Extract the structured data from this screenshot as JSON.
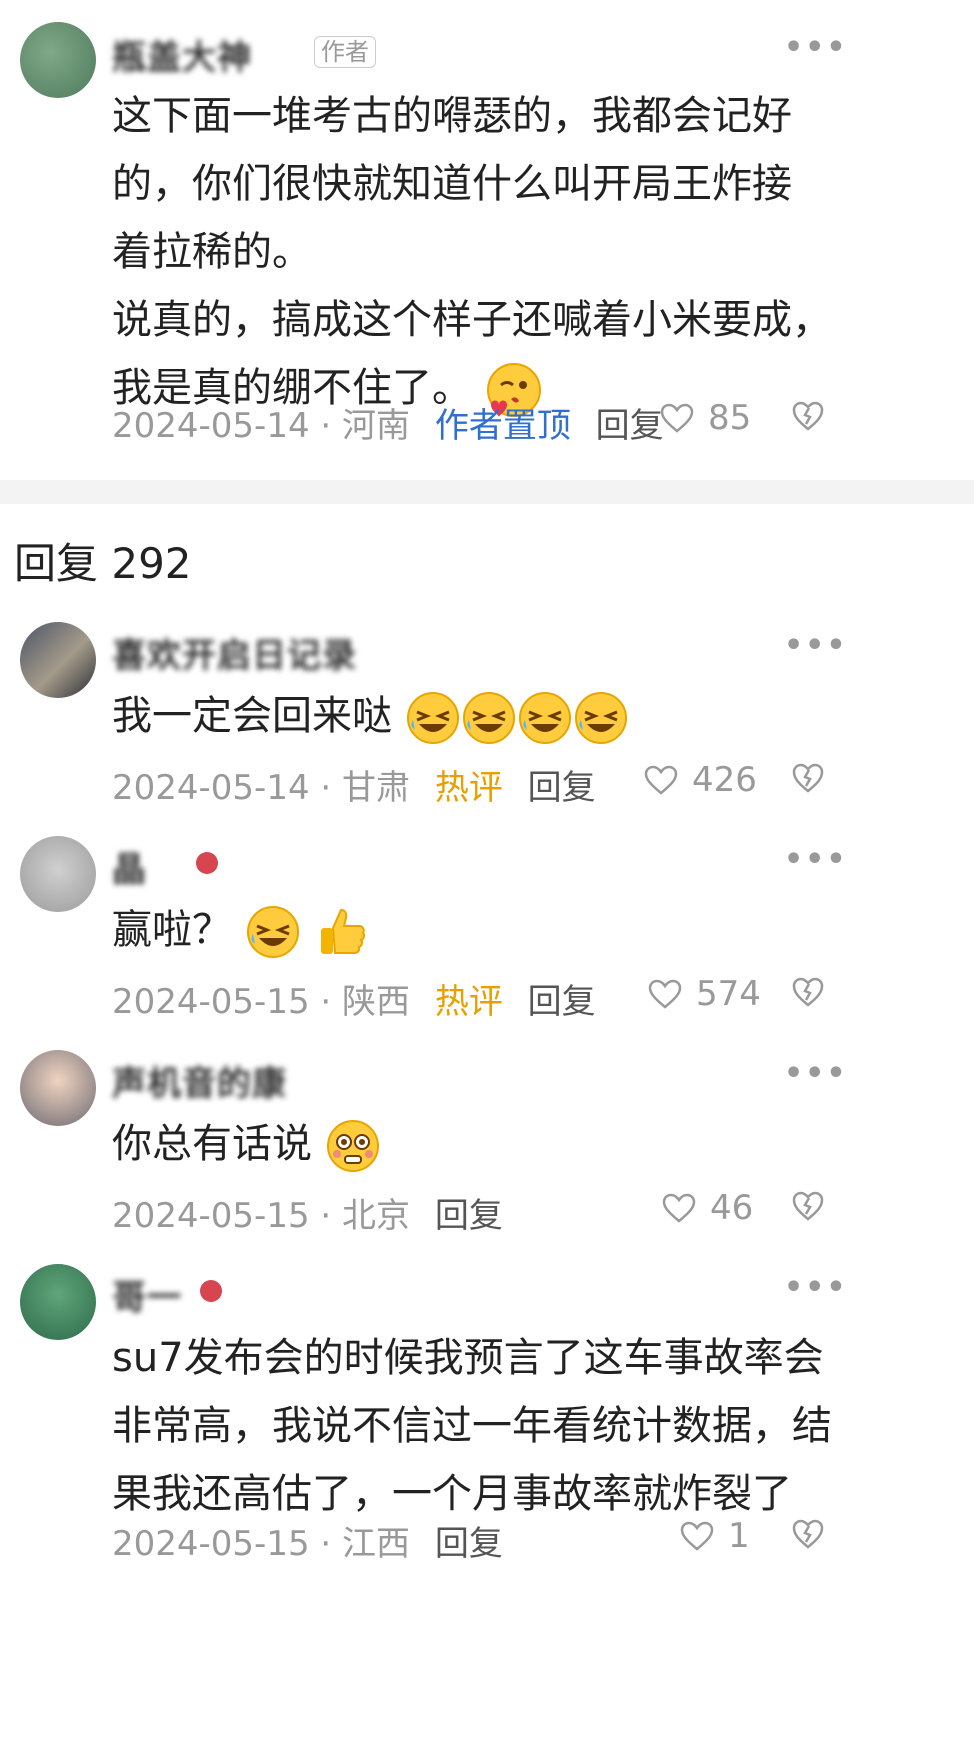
{
  "main_comment": {
    "name": "瓶盖大神",
    "author_tag": "作者",
    "more": "•••",
    "lines": [
      "这下面一堆考古的嘚瑟的，我都会记好",
      "的，你们很快就知道什么叫开局王炸接",
      "着拉稀的。",
      "说真的，搞成这个样子还喊着小米要成，",
      "我是真的绷不住了。"
    ],
    "emoji": "kiss-wink-emoji",
    "date": "2024-05-14",
    "location": "· 河南",
    "pinned_label": "作者置顶",
    "reply_label": "回复",
    "likes": "85"
  },
  "replies_header": "回复 292",
  "replies": [
    {
      "name": "喜欢开启日记录",
      "text": "我一定会回来哒",
      "emojis": [
        "rofl-emoji",
        "rofl-emoji",
        "rofl-emoji",
        "rofl-emoji"
      ],
      "date": "2024-05-14",
      "location": "· 甘肃",
      "hot_label": "热评",
      "reply_label": "回复",
      "likes": "426",
      "more": "•••"
    },
    {
      "name": "晶",
      "text": "赢啦？",
      "emojis": [
        "rofl-emoji",
        "thumbs-up-emoji"
      ],
      "date": "2024-05-15",
      "location": "· 陕西",
      "hot_label": "热评",
      "reply_label": "回复",
      "likes": "574",
      "more": "•••"
    },
    {
      "name": "声机音的康",
      "text": "你总有话说",
      "emojis": [
        "flushed-emoji"
      ],
      "date": "2024-05-15",
      "location": "· 北京",
      "reply_label": "回复",
      "likes": "46",
      "more": "•••"
    },
    {
      "name": "哥一",
      "lines": [
        "su7发布会的时候我预言了这车事故率会",
        "非常高，我说不信过一年看统计数据，结",
        "果我还高估了，一个月事故率就炸裂了"
      ],
      "date": "2024-05-15",
      "location": "· 江西",
      "reply_label": "回复",
      "likes": "1",
      "more": "•••"
    }
  ],
  "colors": {
    "pinned_blue": "#2f6fcf",
    "hot_orange": "#e8a000",
    "meta_gray": "#999999",
    "divider": "#f3f3f3"
  }
}
